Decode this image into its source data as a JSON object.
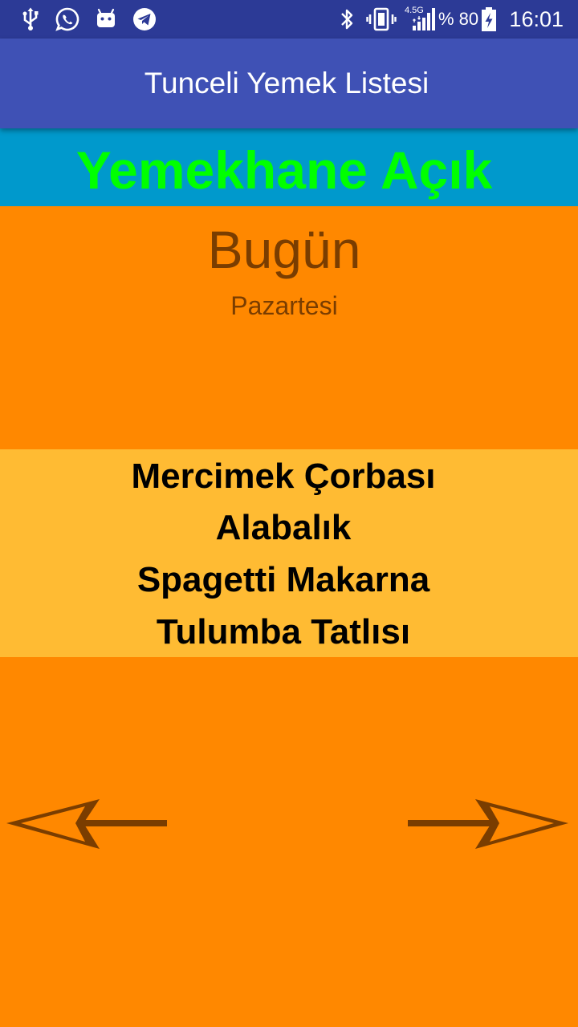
{
  "status_bar": {
    "time": "16:01",
    "battery_percent": "% 80",
    "network_type": "4.5G",
    "left_icons": [
      "usb-icon",
      "whatsapp-icon",
      "android-icon",
      "telegram-icon"
    ],
    "right_icons": [
      "bluetooth-icon",
      "vibrate-icon",
      "signal-icon",
      "battery-charging-icon"
    ]
  },
  "app_bar": {
    "title": "Tunceli Yemek Listesi"
  },
  "banner": {
    "status_text": "Yemekhane Açık"
  },
  "day": {
    "title": "Bugün",
    "weekday": "Pazartesi"
  },
  "menu": {
    "items": [
      {
        "name": "Mercimek Çorbası"
      },
      {
        "name": "Alabalık"
      },
      {
        "name": "Spagetti Makarna"
      },
      {
        "name": "Tulumba Tatlısı"
      }
    ]
  },
  "navigation": {
    "previous": "left-arrow-icon",
    "next": "right-arrow-icon"
  },
  "colors": {
    "status_bar": "#2c3a96",
    "app_bar": "#3f51b5",
    "banner_bg": "#0099cc",
    "banner_text": "#00ff00",
    "page_bg": "#ff8800",
    "menu_bg": "#ffbb33",
    "day_text": "#7a3d00",
    "arrow": "#7a3d00"
  }
}
